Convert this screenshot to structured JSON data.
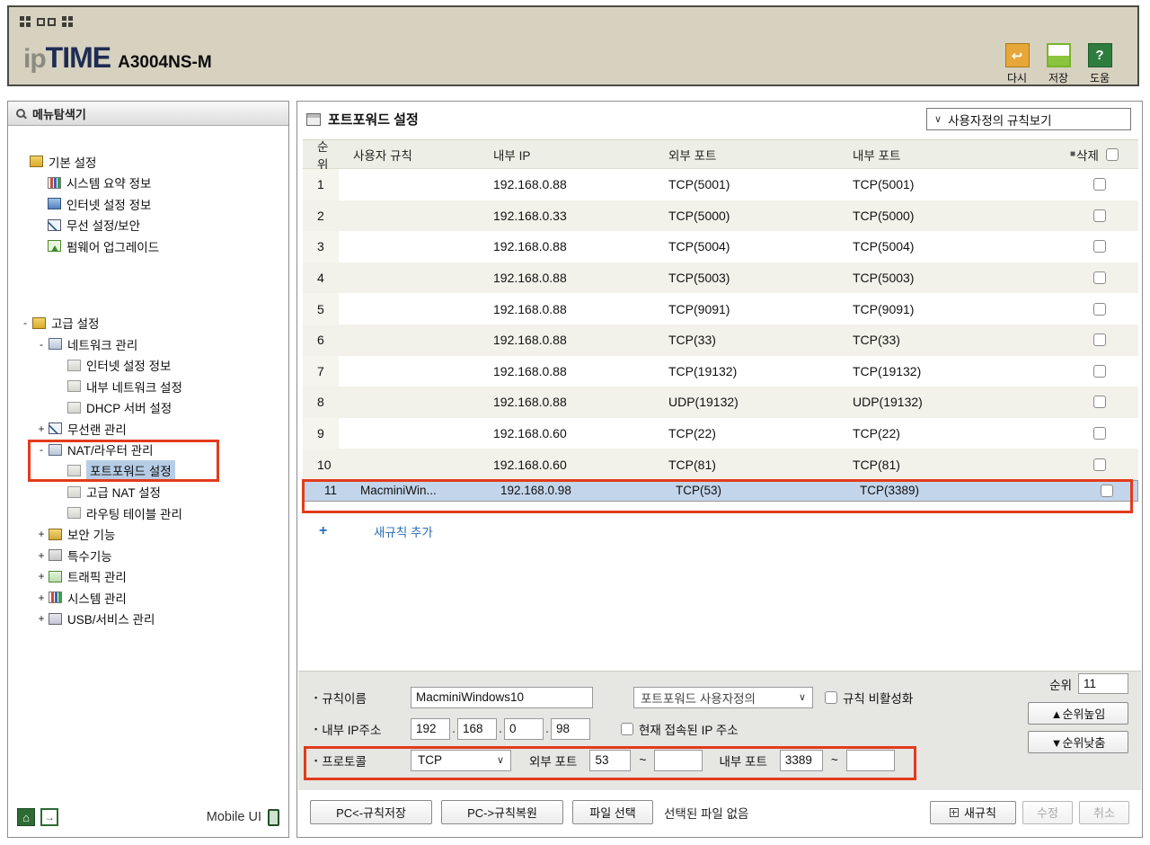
{
  "glyphs": {
    "pm_plus": "+",
    "pm_minus": "-",
    "chev_down": "∨",
    "tilde": "~",
    "bullet": "▪",
    "delete_prefix": "■",
    "undo": "↩",
    "question": "?",
    "house": "⌂",
    "arrow_out": "→",
    "plus_blue": "+",
    "ip_dot": "."
  },
  "header": {
    "logo_ip": "ip",
    "logo_time": "TIME",
    "model": "A3004NS-M",
    "refresh_label": "다시",
    "save_label": "저장",
    "help_label": "도움"
  },
  "sidebar": {
    "title": "메뉴탐색기",
    "basic_root": "기본 설정",
    "basic_items": [
      "시스템 요약 정보",
      "인터넷 설정 정보",
      "무선 설정/보안",
      "펌웨어 업그레이드"
    ],
    "adv_root": "고급 설정",
    "network_root": "네트워크 관리",
    "network_items": [
      "인터넷 설정 정보",
      "내부 네트워크 설정",
      "DHCP 서버 설정"
    ],
    "wlan_root": "무선랜 관리",
    "nat_root": "NAT/라우터 관리",
    "nat_selected": "포트포워드 설정",
    "nat_items": [
      "고급 NAT 설정",
      "라우팅 테이블 관리"
    ],
    "more_items": [
      "보안 기능",
      "특수기능",
      "트래픽 관리",
      "시스템 관리",
      "USB/서비스 관리"
    ],
    "mobile_ui": "Mobile UI"
  },
  "main": {
    "title": "포트포워드 설정",
    "filter": "사용자정의 규칙보기",
    "table": {
      "h_rank": "순위",
      "h_rule": "사용자 규칙",
      "h_ip": "내부 IP",
      "h_ext": "외부 포트",
      "h_int": "내부 포트",
      "h_del": "삭제",
      "rows": [
        {
          "rank": "1",
          "rule": "",
          "ip": "192.168.0.88",
          "ext": "TCP(5001)",
          "int": "TCP(5001)"
        },
        {
          "rank": "2",
          "rule": "",
          "ip": "192.168.0.33",
          "ext": "TCP(5000)",
          "int": "TCP(5000)"
        },
        {
          "rank": "3",
          "rule": "",
          "ip": "192.168.0.88",
          "ext": "TCP(5004)",
          "int": "TCP(5004)"
        },
        {
          "rank": "4",
          "rule": "",
          "ip": "192.168.0.88",
          "ext": "TCP(5003)",
          "int": "TCP(5003)"
        },
        {
          "rank": "5",
          "rule": "",
          "ip": "192.168.0.88",
          "ext": "TCP(9091)",
          "int": "TCP(9091)"
        },
        {
          "rank": "6",
          "rule": "",
          "ip": "192.168.0.88",
          "ext": "TCP(33)",
          "int": "TCP(33)"
        },
        {
          "rank": "7",
          "rule": "",
          "ip": "192.168.0.88",
          "ext": "TCP(19132)",
          "int": "TCP(19132)"
        },
        {
          "rank": "8",
          "rule": "",
          "ip": "192.168.0.88",
          "ext": "UDP(19132)",
          "int": "UDP(19132)"
        },
        {
          "rank": "9",
          "rule": "",
          "ip": "192.168.0.60",
          "ext": "TCP(22)",
          "int": "TCP(22)"
        },
        {
          "rank": "10",
          "rule": "",
          "ip": "192.168.0.60",
          "ext": "TCP(81)",
          "int": "TCP(81)"
        },
        {
          "rank": "11",
          "rule": "MacminiWin...",
          "ip": "192.168.0.98",
          "ext": "TCP(53)",
          "int": "TCP(3389)"
        }
      ]
    },
    "add_rule": "새규칙 추가",
    "form": {
      "rule_name_label": "규칙이름",
      "rule_name_value": "MacminiWindows10",
      "rule_type": "포트포워드 사용자정의",
      "disable_label": "규칙 비활성화",
      "rank_label": "순위",
      "rank_value": "11",
      "ip_label": "내부 IP주소",
      "ip1": "192",
      "ip2": "168",
      "ip3": "0",
      "ip4": "98",
      "current_ip_label": "현재 접속된 IP 주소",
      "rank_up": "▲순위높임",
      "rank_down": "▼순위낮춤",
      "protocol_label": "프로토콜",
      "protocol_value": "TCP",
      "ext_label": "외부 포트",
      "ext_value": "53",
      "ext_end": "",
      "int_label": "내부 포트",
      "int_value": "3389",
      "int_end": ""
    },
    "footer": {
      "save_pc": "PC<-규칙저장",
      "restore_pc": "PC->규칙복원",
      "file_select": "파일 선택",
      "no_file": "선택된 파일 없음",
      "new_rule": "새규칙",
      "modify": "수정",
      "cancel": "취소"
    }
  }
}
